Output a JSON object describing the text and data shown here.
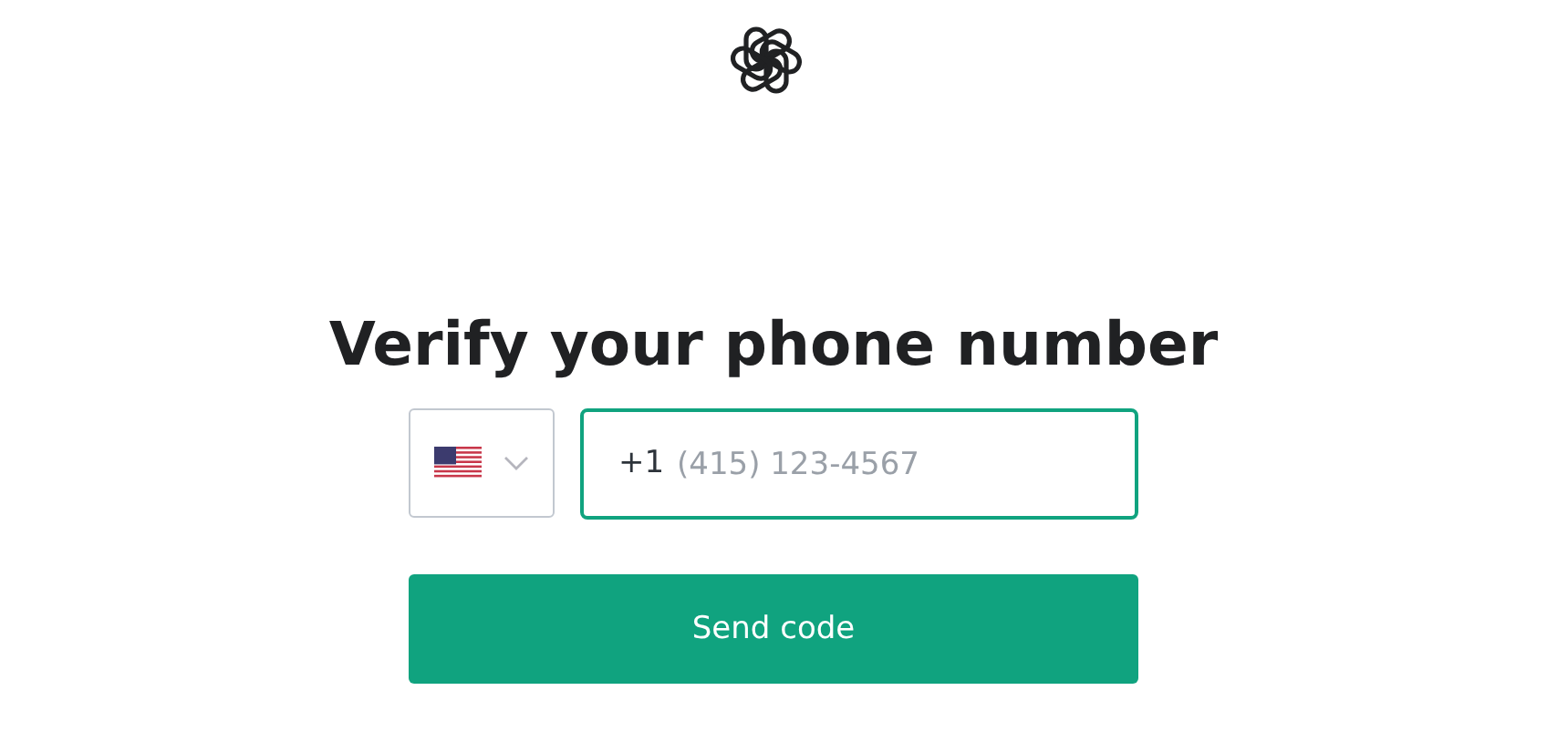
{
  "heading": "Verify your phone number",
  "phone": {
    "prefix": "+1",
    "placeholder": "(415) 123-4567",
    "focused": true
  },
  "submit": {
    "label": "Send code"
  }
}
